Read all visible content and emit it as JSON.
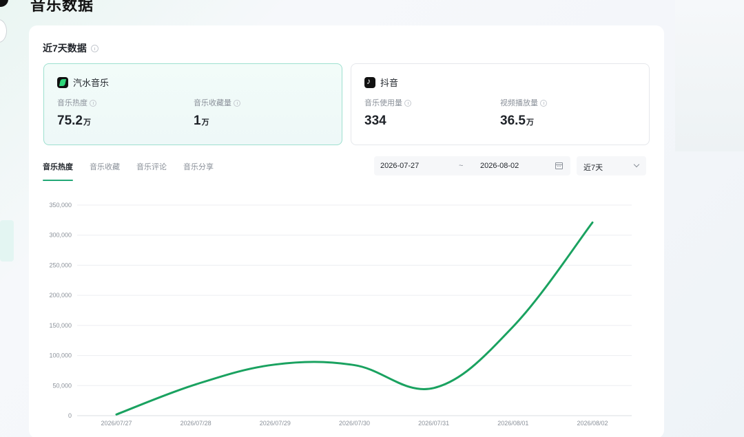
{
  "page": {
    "title": "音乐数据"
  },
  "section": {
    "title": "近7天数据"
  },
  "platforms": [
    {
      "name": "汽水音乐",
      "logo": "qishui-music-logo-icon",
      "metrics": [
        {
          "label": "音乐热度",
          "value": "75.2",
          "unit": "万"
        },
        {
          "label": "音乐收藏量",
          "value": "1",
          "unit": "万"
        }
      ]
    },
    {
      "name": "抖音",
      "logo": "douyin-logo-icon",
      "metrics": [
        {
          "label": "音乐使用量",
          "value": "334",
          "unit": ""
        },
        {
          "label": "视频播放量",
          "value": "36.5",
          "unit": "万"
        }
      ]
    }
  ],
  "tabs": [
    {
      "label": "音乐热度",
      "active": true
    },
    {
      "label": "音乐收藏",
      "active": false
    },
    {
      "label": "音乐评论",
      "active": false
    },
    {
      "label": "音乐分享",
      "active": false
    }
  ],
  "date_range": {
    "start": "2026-07-27",
    "separator": "~",
    "end": "2026-08-02"
  },
  "range_select": {
    "value": "近7天"
  },
  "colors": {
    "accent": "#22a876",
    "line": "#1aa260"
  },
  "chart_data": {
    "type": "line",
    "x": [
      "2026/07/27",
      "2026/07/28",
      "2026/07/29",
      "2026/07/30",
      "2026/07/31",
      "2026/08/01",
      "2026/08/02"
    ],
    "series": [
      {
        "values": [
          2000,
          52000,
          85000,
          84000,
          46000,
          148000,
          321000
        ]
      }
    ],
    "yticks": [
      "350,000",
      "300,000",
      "250,000",
      "200,000",
      "150,000",
      "100,000",
      "50,000",
      "0"
    ],
    "ylim": [
      0,
      350000
    ],
    "grid": true
  }
}
